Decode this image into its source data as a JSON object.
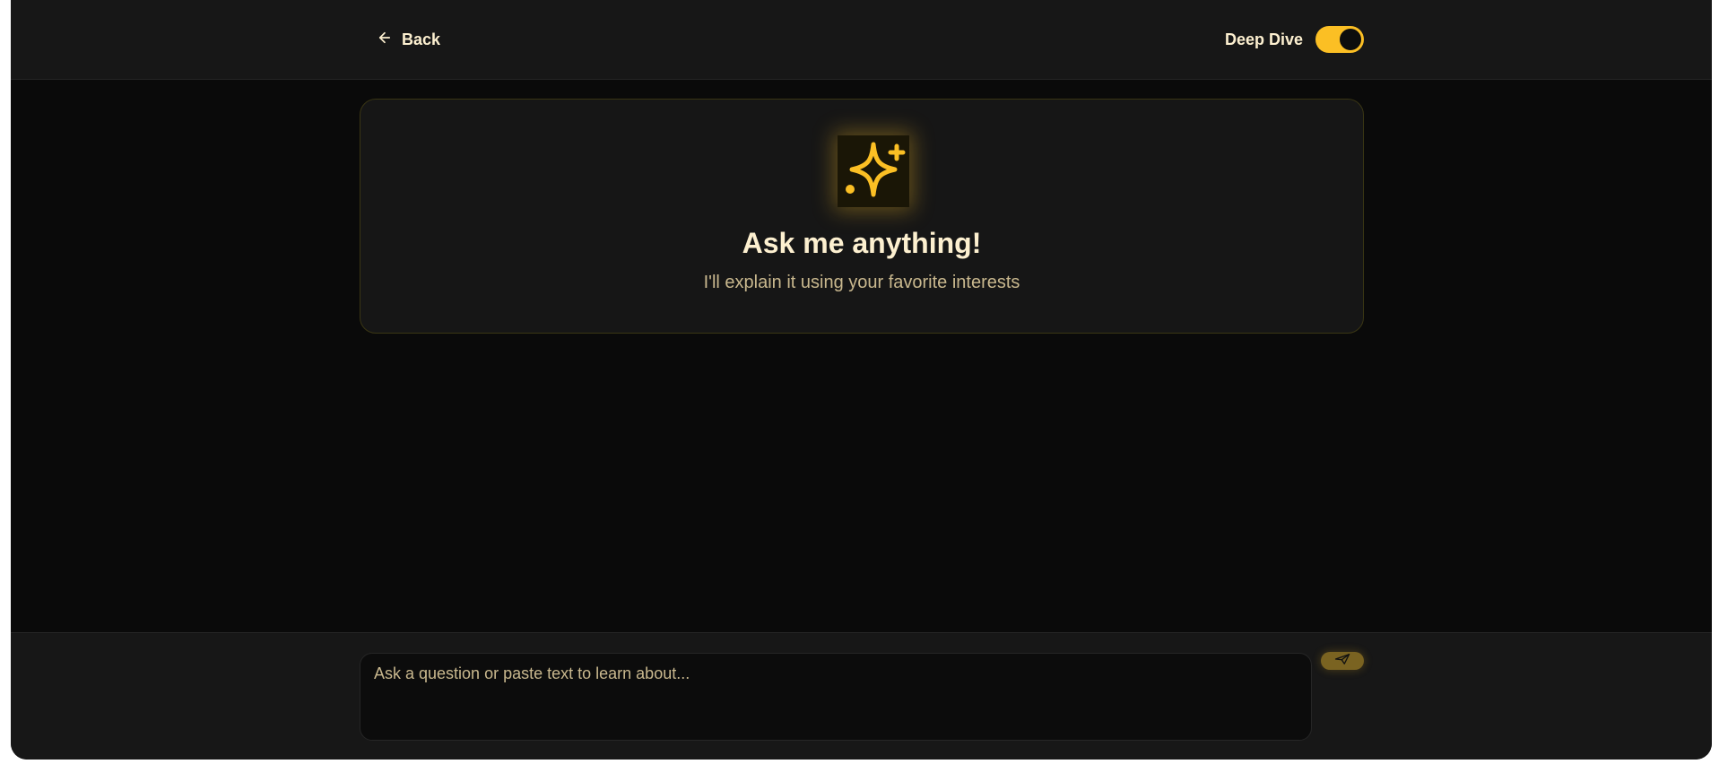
{
  "header": {
    "back_label": "Back",
    "deep_dive_label": "Deep Dive",
    "deep_dive_enabled": true
  },
  "hero": {
    "icon": "sparkle-icon",
    "title": "Ask me anything!",
    "subtitle": "I'll explain it using your favorite interests"
  },
  "composer": {
    "placeholder": "Ask a question or paste text to learn about...",
    "value": "",
    "send_icon": "send-icon"
  },
  "colors": {
    "accent": "#fbbf24",
    "background": "#0a0a0a",
    "surface": "#171717",
    "text_primary": "#fdf0d0",
    "text_secondary": "#c9b88e"
  }
}
